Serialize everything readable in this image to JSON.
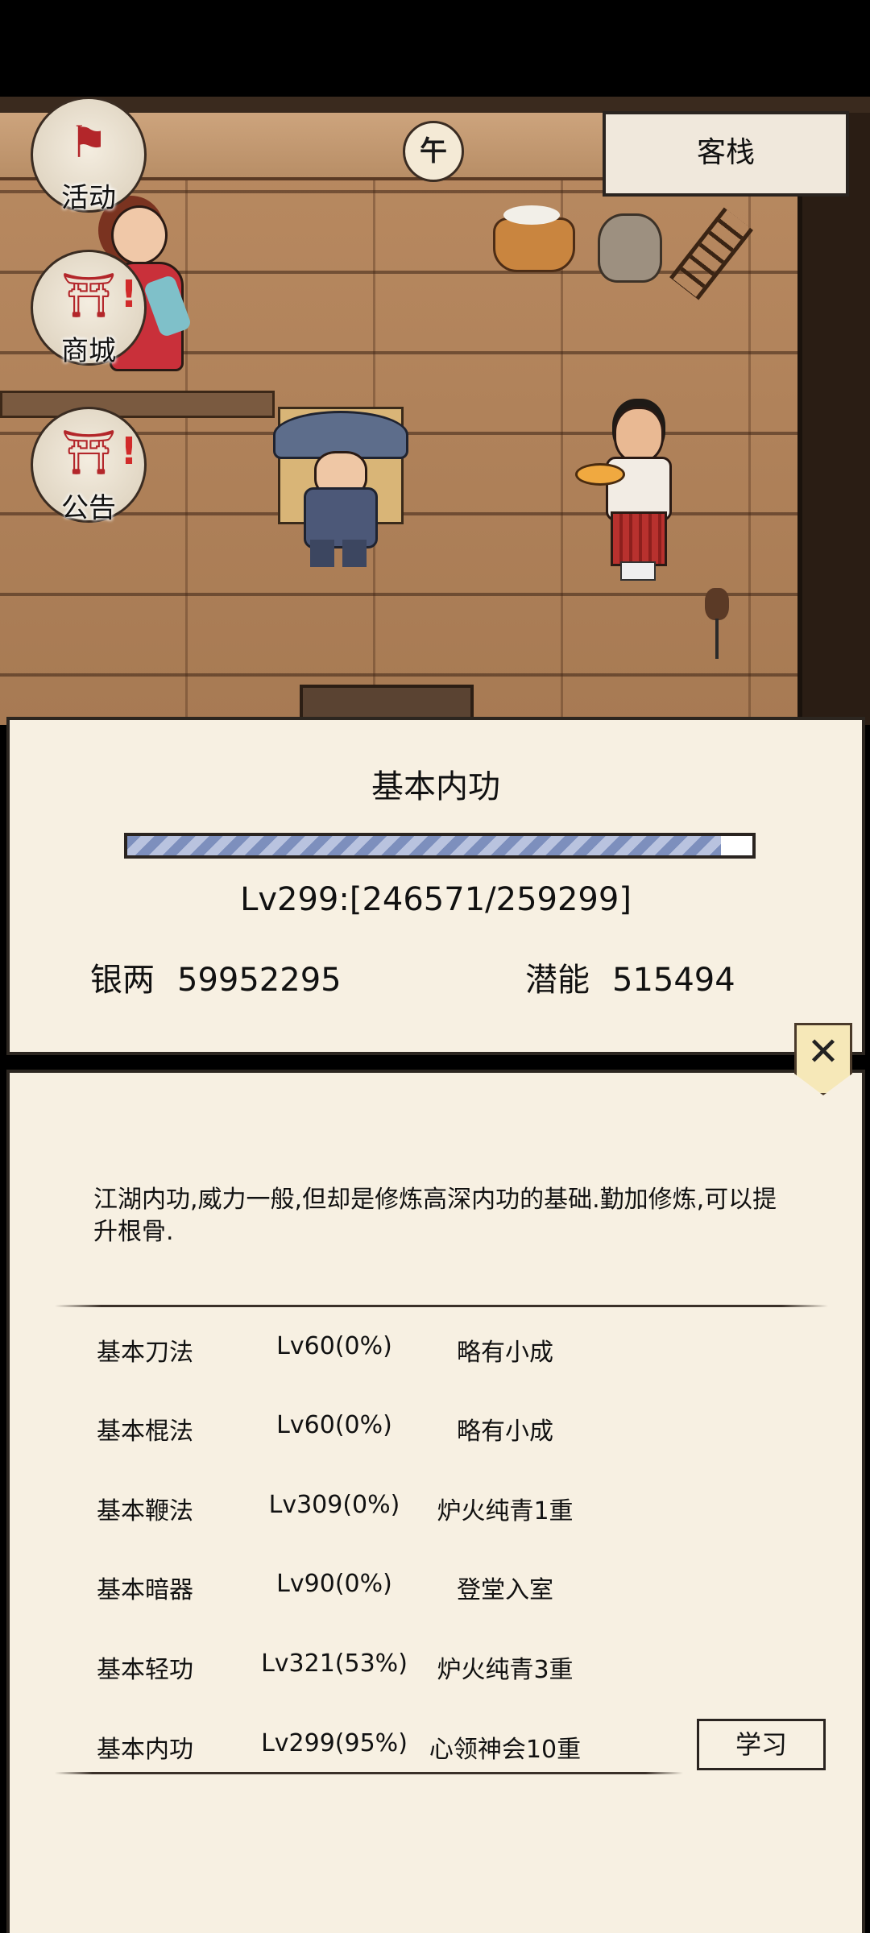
{
  "scene": {
    "location_sign": "客栈",
    "time_glyph": "午",
    "side_buttons": [
      {
        "label": "活动",
        "icon": "banner-icon"
      },
      {
        "label": "商城",
        "icon": "shop-icon",
        "alert": "!"
      },
      {
        "label": "公告",
        "icon": "notice-icon",
        "alert": "!"
      }
    ]
  },
  "skill": {
    "title": "基本内功",
    "progress": 0.95,
    "level_text": "Lv299:[246571/259299]",
    "silver_label": "银两",
    "silver_value": "59952295",
    "potential_label": "潜能",
    "potential_value": "515494"
  },
  "close_label": "✕",
  "detail": {
    "description": "江湖内功,威力一般,但却是修炼高深内功的基础.勤加修炼,可以提升根骨.",
    "rows": [
      {
        "name": "基本刀法",
        "level": "Lv60(0%)",
        "rank": "略有小成"
      },
      {
        "name": "基本棍法",
        "level": "Lv60(0%)",
        "rank": "略有小成"
      },
      {
        "name": "基本鞭法",
        "level": "Lv309(0%)",
        "rank": "炉火纯青1重"
      },
      {
        "name": "基本暗器",
        "level": "Lv90(0%)",
        "rank": "登堂入室"
      },
      {
        "name": "基本轻功",
        "level": "Lv321(53%)",
        "rank": "炉火纯青3重"
      },
      {
        "name": "基本内功",
        "level": "Lv299(95%)",
        "rank": "心领神会10重"
      }
    ],
    "learn_label": "学习"
  },
  "colors": {
    "panel_bg": "#f7f0e2",
    "border": "#2c2620",
    "progress_fill": "#7d8fbd",
    "alert_red": "#d12a2a"
  }
}
